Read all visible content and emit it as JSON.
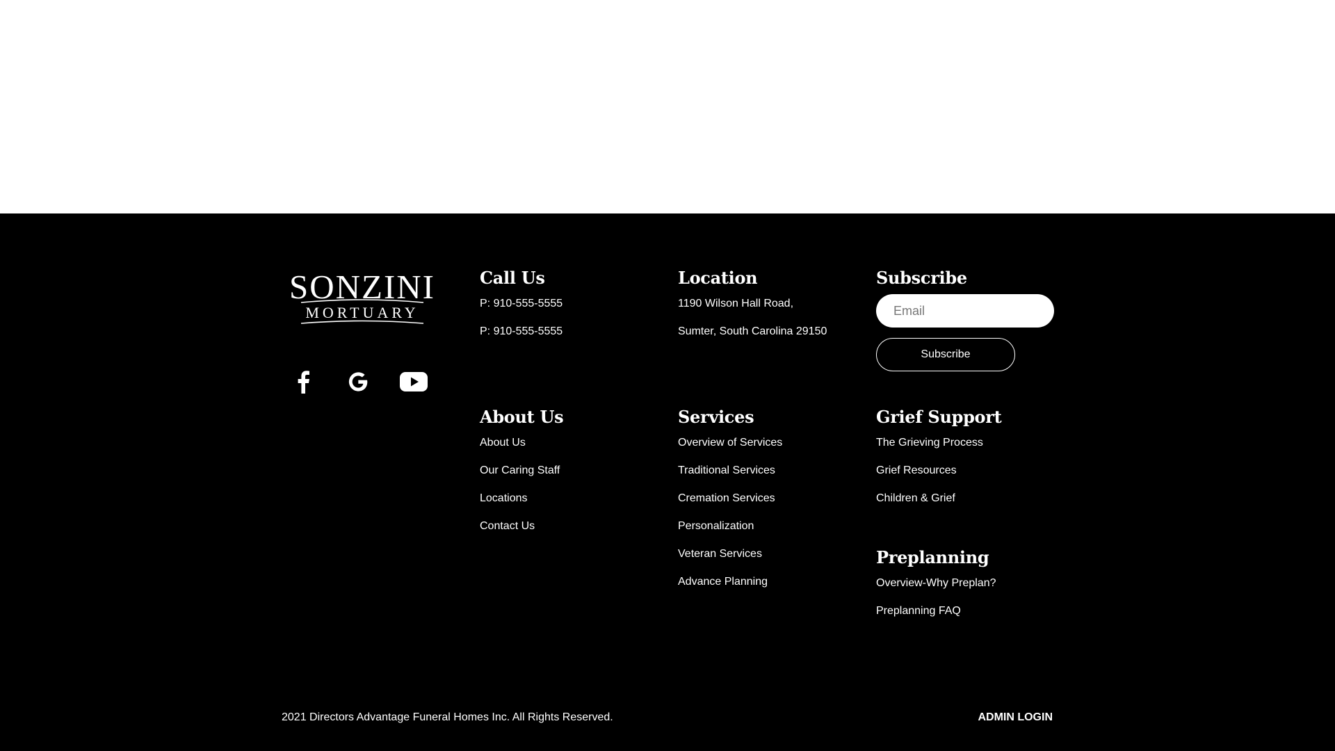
{
  "logo": {
    "line1": "SONZINI",
    "line2": "MORTUARY"
  },
  "social": {
    "facebook": "facebook-icon",
    "google": "google-icon",
    "youtube": "youtube-icon"
  },
  "call_us": {
    "title": "Call Us",
    "lines": [
      "P: 910-555-5555",
      "P: 910-555-5555"
    ]
  },
  "location": {
    "title": "Location",
    "lines": [
      "1190 Wilson Hall Road,",
      "Sumter, South Carolina 29150"
    ]
  },
  "subscribe": {
    "title": "Subscribe",
    "email_placeholder": "Email",
    "email_value": "",
    "button_label": "Subscribe"
  },
  "about_us": {
    "title": "About Us",
    "links": [
      "About Us",
      "Our Caring Staff",
      "Locations",
      "Contact Us"
    ]
  },
  "services": {
    "title": "Services",
    "links": [
      "Overview of Services",
      "Traditional Services",
      "Cremation Services",
      "Personalization",
      "Veteran Services",
      "Advance Planning"
    ]
  },
  "grief_support": {
    "title": "Grief Support",
    "links": [
      "The Grieving Process",
      "Grief Resources",
      "Children & Grief"
    ]
  },
  "preplanning": {
    "title": "Preplanning",
    "links": [
      "Overview-Why Preplan?",
      "Preplanning FAQ"
    ]
  },
  "bottom": {
    "copyright": "2021 Directors Advantage Funeral Homes Inc. All Rights Reserved.",
    "admin_login": "ADMIN LOGIN"
  },
  "colors": {
    "footer_bg": "#000000",
    "footer_text": "#ffffff",
    "page_bg": "#ffffff"
  }
}
